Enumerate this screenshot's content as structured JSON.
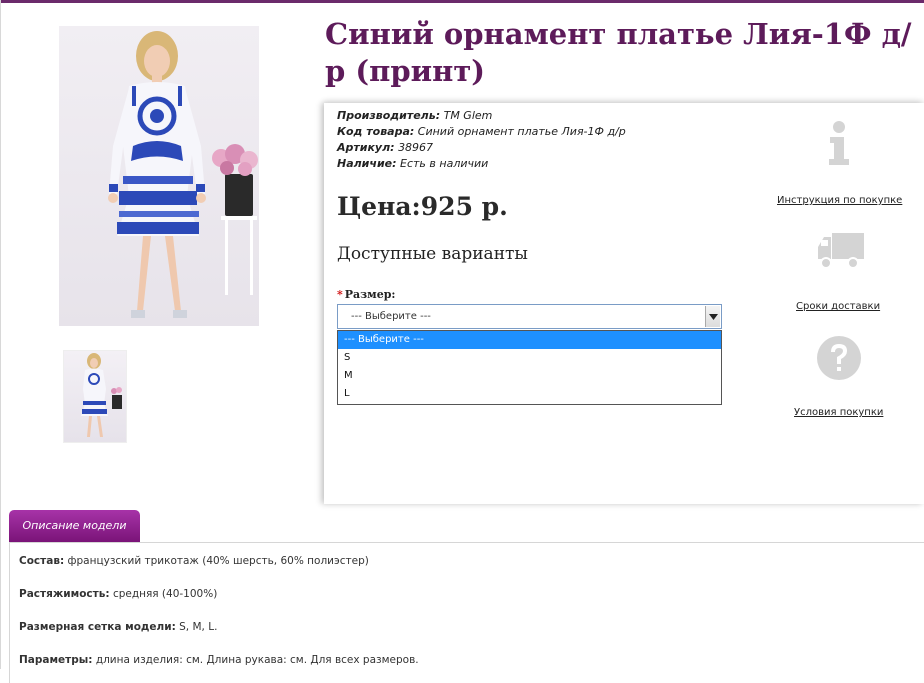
{
  "product": {
    "title": "Синий орнамент платье Лия-1Ф д/р (принт)"
  },
  "meta": {
    "manufacturer_label": "Производитель:",
    "manufacturer": "ТМ Glem",
    "code_label": "Код товара:",
    "code": "Синий орнамент платье Лия-1Ф д/р",
    "article_label": "Артикул:",
    "article": "38967",
    "availability_label": "Наличие:",
    "availability": "Есть в наличии"
  },
  "price": "Цена:925 р.",
  "variants_heading": "Доступные варианты",
  "size": {
    "required_mark": "*",
    "label": "Размер:",
    "selected": "--- Выберите ---",
    "options": [
      "--- Выберите ---",
      "S",
      "M",
      "L"
    ],
    "highlighted_index": 0
  },
  "side_links": {
    "instructions": "Инструкция по покупке",
    "delivery": "Сроки доставки",
    "conditions": "Условия покупки"
  },
  "icons": {
    "info": "info-icon",
    "truck": "truck-icon",
    "question": "question-icon",
    "dropdown_arrow": "chevron-down-icon"
  },
  "colors": {
    "title": "#5d1b5a",
    "tab": "#8f1f8d",
    "accent_border": "#6b2a6b",
    "selection": "#1e90ff"
  },
  "description": {
    "tab_label": "Описание модели",
    "lines": [
      {
        "key": "Состав:",
        "value": "французский трикотаж (40% шерсть, 60% полиэстер)"
      },
      {
        "key": "Растяжимость:",
        "value": "средняя (40-100%)"
      },
      {
        "key": "Размерная сетка модели:",
        "value": "S, M, L."
      },
      {
        "key": "Параметры:",
        "value": "длина изделия: см. Длина рукава: см. Для всех размеров."
      }
    ]
  }
}
